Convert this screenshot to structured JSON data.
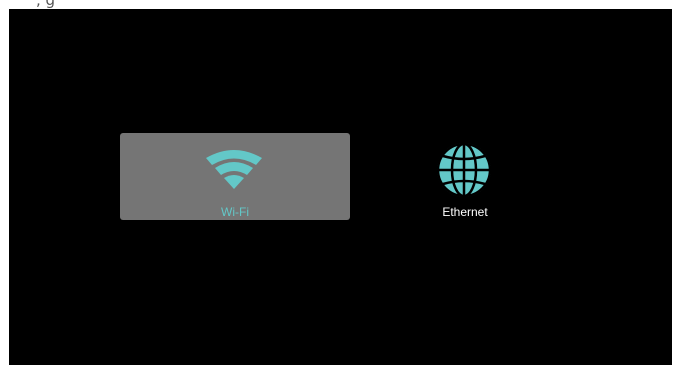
{
  "top_strip": {
    "clipped_text": ", g"
  },
  "network_options": {
    "selected": "Wi-Fi",
    "items": [
      {
        "label": "Wi-Fi",
        "icon": "wifi-icon",
        "selected": true
      },
      {
        "label": "Ethernet",
        "icon": "globe-icon",
        "selected": false
      }
    ]
  },
  "colors": {
    "background": "#000000",
    "selected_tile": "#757575",
    "accent": "#63c8c8",
    "label_default": "#ffffff"
  }
}
